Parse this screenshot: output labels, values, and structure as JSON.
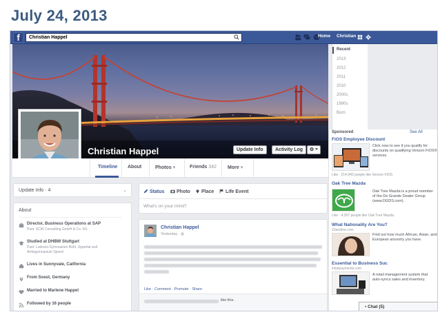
{
  "slide_title": "July 24, 2013",
  "topbar": {
    "search_value": "Christian Happel",
    "home_label": "Home",
    "profile_label": "Christian"
  },
  "profile": {
    "name": "Christian Happel",
    "update_info_label": "Update Info",
    "activity_log_label": "Activity Log"
  },
  "tabs": {
    "timeline": "Timeline",
    "about": "About",
    "photos": "Photos",
    "friends": "Friends",
    "friends_count": "342",
    "more": "More"
  },
  "timeline_nav": [
    "Recent",
    "2013",
    "2012",
    "2011",
    "2010",
    "2000s",
    "1990s",
    "Born"
  ],
  "update_info_card": {
    "label": "Update Info",
    "count": "4"
  },
  "about": {
    "title": "About",
    "items": [
      {
        "icon": "briefcase-icon",
        "label": "Director, Business Operations at SAP",
        "sub": "Past: SCW Consulting GmbH & Co. KG"
      },
      {
        "icon": "graduation-cap-icon",
        "label": "Studied at DHBW Stuttgart",
        "sub": "Past: Ludovici-Gymnasium Bühl, Uppertal and",
        "sub2": "Amtsgymnasium Speed"
      },
      {
        "icon": "house-icon",
        "label": "Lives in Sunnyvale, California"
      },
      {
        "icon": "location-pin-icon",
        "label": "From Soest, Germany"
      },
      {
        "icon": "heart-icon",
        "label": "Married to Marlene Happel"
      },
      {
        "icon": "rss-icon",
        "label": "Followed by 16 people"
      }
    ]
  },
  "composer": {
    "status_label": "Status",
    "photo_label": "Photo",
    "place_label": "Place",
    "life_event_label": "Life Event",
    "placeholder": "What's on your mind?"
  },
  "post": {
    "author": "Christian Happel",
    "time": "Yesterday",
    "actions": "Like · Comment · Promote · Share",
    "like_suffix": "like this."
  },
  "sponsored": {
    "header": "Sponsored",
    "see_all": "See All",
    "ads": [
      {
        "title": "FiOS Employee Discount",
        "body": "Click now to see if you qualify for discounts on qualifying Verizon FiOS® services.",
        "likes": "Like · 214,940 people like Verizon FiOS."
      },
      {
        "title": "Oak Tree Mazda",
        "body": "Oak Tree Mazda is a proud member of the De Grande Dealer Group (www.DGDS.com).",
        "likes": "Like · 4,357 people like Oak Tree Mazda."
      },
      {
        "title": "What Nationality Are You?",
        "body": "Find out how much African, Asian, and European ancestry you have."
      },
      {
        "title": "Essential to Business Suc",
        "body": "A retail management system that auto-syncs sales and inventory."
      }
    ],
    "ad_sub": "23andme.com",
    "ad_sub2": "intuitpayments.com"
  },
  "chat": {
    "label": "Chat",
    "count": "(5)"
  },
  "colors": {
    "brand": "#3b5998",
    "title": "#3b5a80"
  }
}
